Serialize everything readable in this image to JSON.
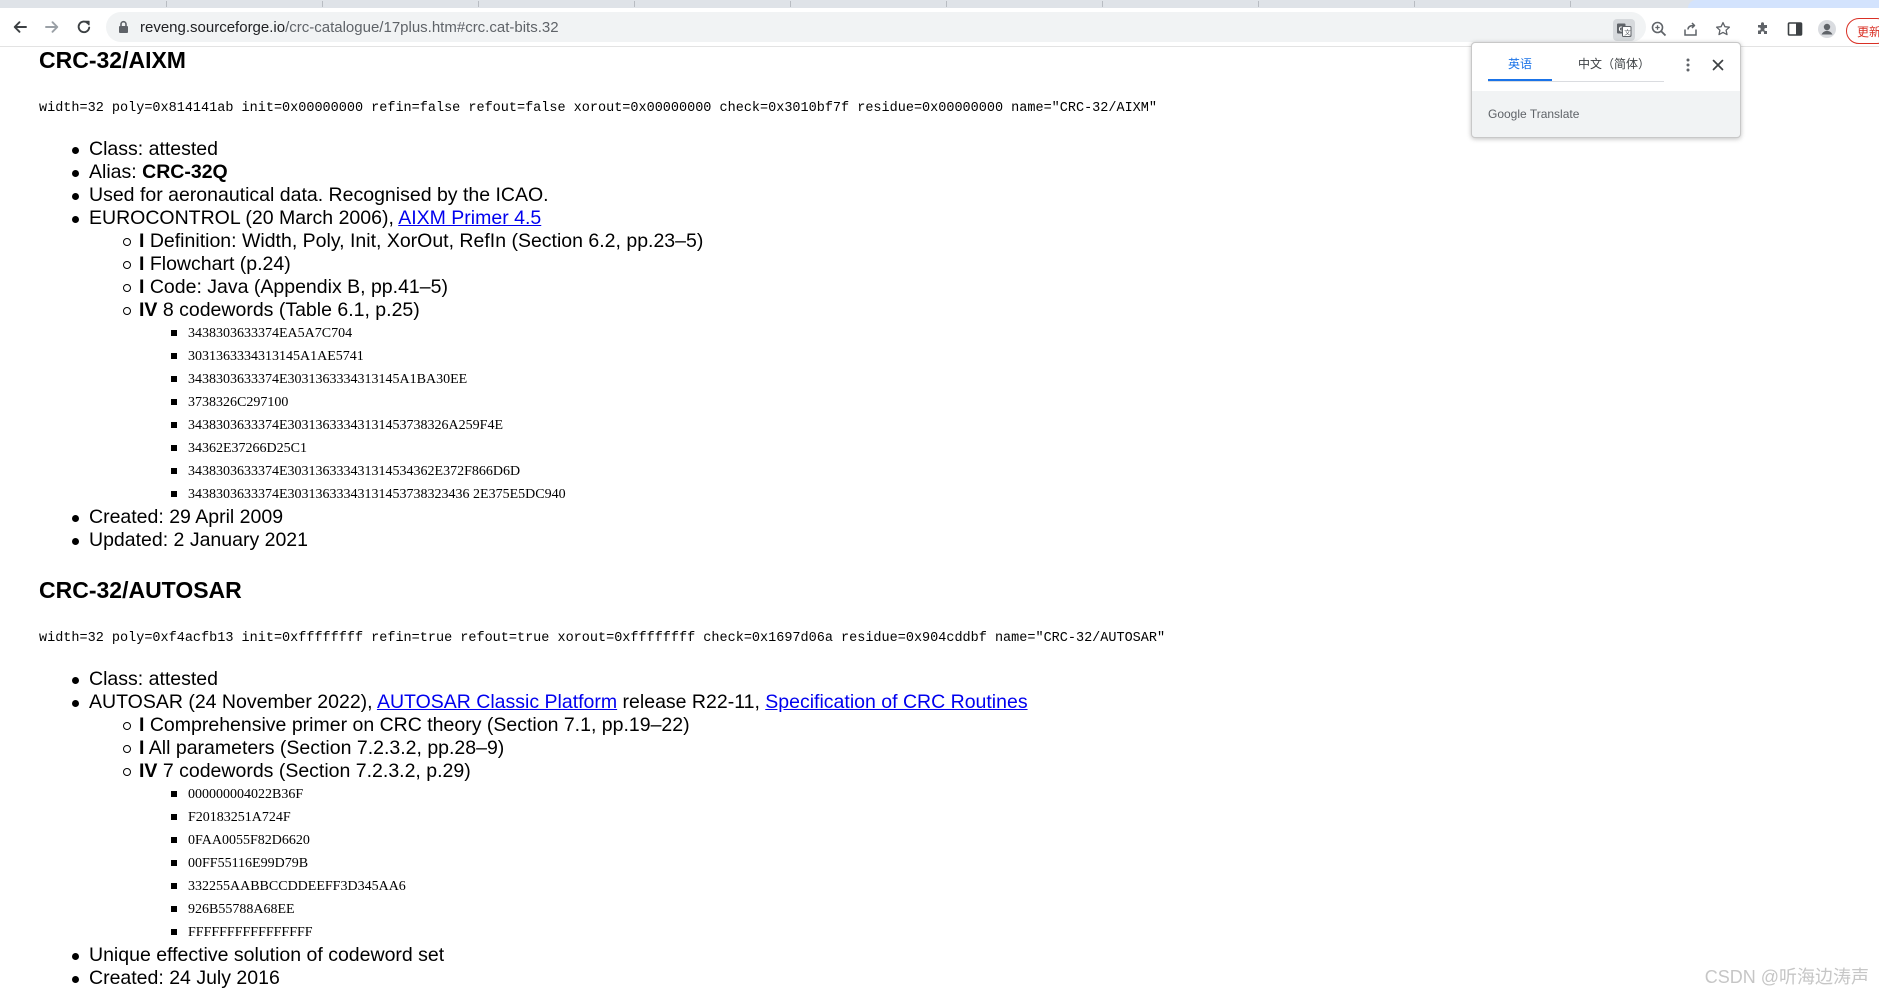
{
  "browser": {
    "url_host": "reveng.sourceforge.io",
    "url_path": "/crc-catalogue/17plus.htm#crc.cat-bits.32",
    "update_label": "更新"
  },
  "translate_popup": {
    "source_lang": "英语",
    "target_lang": "中文（简体）",
    "brand_google": "Google",
    "brand_translate": "Translate"
  },
  "entry_aixm": {
    "title": "CRC-32/AIXM",
    "spec": "width=32 poly=0x814141ab init=0x00000000 refin=false refout=false xorout=0x00000000 check=0x3010bf7f residue=0x00000000 name=\"CRC-32/AIXM\"",
    "class_text": "Class: attested",
    "alias_prefix": "Alias: ",
    "alias_value": "CRC-32Q",
    "usage": "Used for aeronautical data. Recognised by the ICAO.",
    "source_prefix": "EUROCONTROL (20 March 2006), ",
    "source_link": "AIXM Primer 4.5",
    "sub": [
      {
        "grade": "I",
        "text": " Definition: Width, Poly, Init, XorOut, RefIn (Section 6.2, pp.23–5)"
      },
      {
        "grade": "I",
        "text": " Flowchart (p.24)"
      },
      {
        "grade": "I",
        "text": " Code: Java (Appendix B, pp.41–5)"
      },
      {
        "grade": "IV",
        "text": " 8 codewords (Table 6.1, p.25)"
      }
    ],
    "codewords": [
      "3438303633374EA5A7C704",
      "3031363334313145A1AE5741",
      "3438303633374E3031363334313145A1BA30EE",
      "3738326C297100",
      "3438303633374E30313633343131453738326A259F4E",
      "34362E37266D25C1",
      "3438303633374E303136333431314534362E372F866D6D",
      "3438303633374E30313633343131453738323436 2E375E5DC940"
    ],
    "created": "Created: 29 April 2009",
    "updated": "Updated: 2 January 2021"
  },
  "entry_autosar": {
    "title": "CRC-32/AUTOSAR",
    "spec": "width=32 poly=0xf4acfb13 init=0xffffffff refin=true refout=true xorout=0xffffffff check=0x1697d06a residue=0x904cddbf name=\"CRC-32/AUTOSAR\"",
    "class_text": "Class: attested",
    "source_prefix": "AUTOSAR (24 November 2022), ",
    "source_link1": "AUTOSAR Classic Platform",
    "source_mid": " release R22-11, ",
    "source_link2": "Specification of CRC Routines",
    "sub": [
      {
        "grade": "I",
        "text": " Comprehensive primer on CRC theory (Section 7.1, pp.19–22)"
      },
      {
        "grade": "I",
        "text": " All parameters (Section 7.2.3.2, pp.28–9)"
      },
      {
        "grade": "IV",
        "text": " 7 codewords (Section 7.2.3.2, p.29)"
      }
    ],
    "codewords": [
      "000000004022B36F",
      "F20183251A724F",
      "0FAA0055F82D6620",
      "00FF55116E99D79B",
      "332255AABBCCDDEEFF3D345AA6",
      "926B55788A68EE",
      "FFFFFFFFFFFFFFFF"
    ],
    "unique": "Unique effective solution of codeword set",
    "created": "Created: 24 July 2016"
  },
  "watermark": "CSDN @听海边涛声"
}
